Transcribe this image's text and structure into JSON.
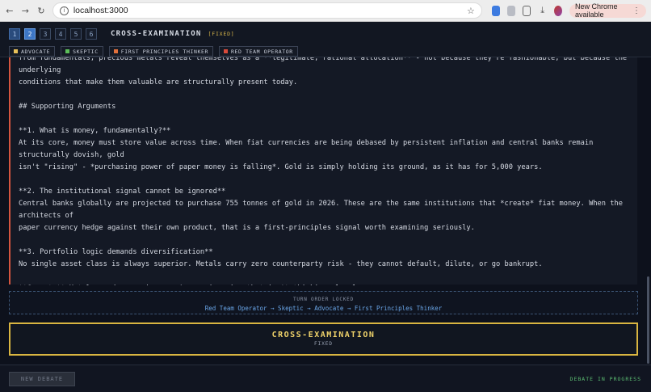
{
  "browser": {
    "url": "localhost:3000",
    "update_label": "New Chrome available"
  },
  "header": {
    "steps": [
      "1",
      "2",
      "3",
      "4",
      "5",
      "6"
    ],
    "phase_title": "CROSS-EXAMINATION",
    "phase_tag": "[FIXED]",
    "participants": [
      {
        "label": "ADVOCATE",
        "color": "#e8c15a"
      },
      {
        "label": "SKEPTIC",
        "color": "#5dbf5a"
      },
      {
        "label": "FIRST PRINCIPLES THINKER",
        "color": "#e0703c"
      },
      {
        "label": "RED TEAM OPERATOR",
        "color": "#d94a3a"
      }
    ]
  },
  "transcript": {
    "lines": [
      "from fundamentals, precious metals reveal themselves as a **legitimate, rational allocation** - not because they're fashionable, but because the underlying",
      "conditions that make them valuable are structurally present today.",
      "",
      "## Supporting Arguments",
      "",
      "**1. What is money, fundamentally?**",
      "At its core, money must store value across time. When fiat currencies are being debased by persistent inflation and central banks remain structurally dovish, gold",
      "isn't \"rising\" - *purchasing power of paper money is falling*. Gold is simply holding its ground, as it has for 5,000 years.",
      "",
      "**2. The institutional signal cannot be ignored**",
      "Central banks globally are projected to purchase 755 tonnes of gold in 2026. These are the same institutions that *create* fiat money. When the architects of",
      "paper currency hedge against their own product, that is a first-principles signal worth examining seriously.",
      "",
      "**3. Portfolio logic demands diversification**",
      "No single asset class is always superior. Metals carry zero counterparty risk - they cannot default, dilute, or go bankrupt.",
      "",
      "**Caveat:** Metals produce no income. Anyone ignoring that isn't thinking clearly."
    ]
  },
  "turn_order": {
    "label": "TURN ORDER LOCKED",
    "sequence": "Red Team Operator → Skeptic → Advocate → First Principles Thinker"
  },
  "phase_banner": {
    "name": "CROSS-EXAMINATION",
    "sub": "FIXED"
  },
  "footer": {
    "new_debate_label": "NEW DEBATE",
    "status": "DEBATE IN PROGRESS"
  }
}
